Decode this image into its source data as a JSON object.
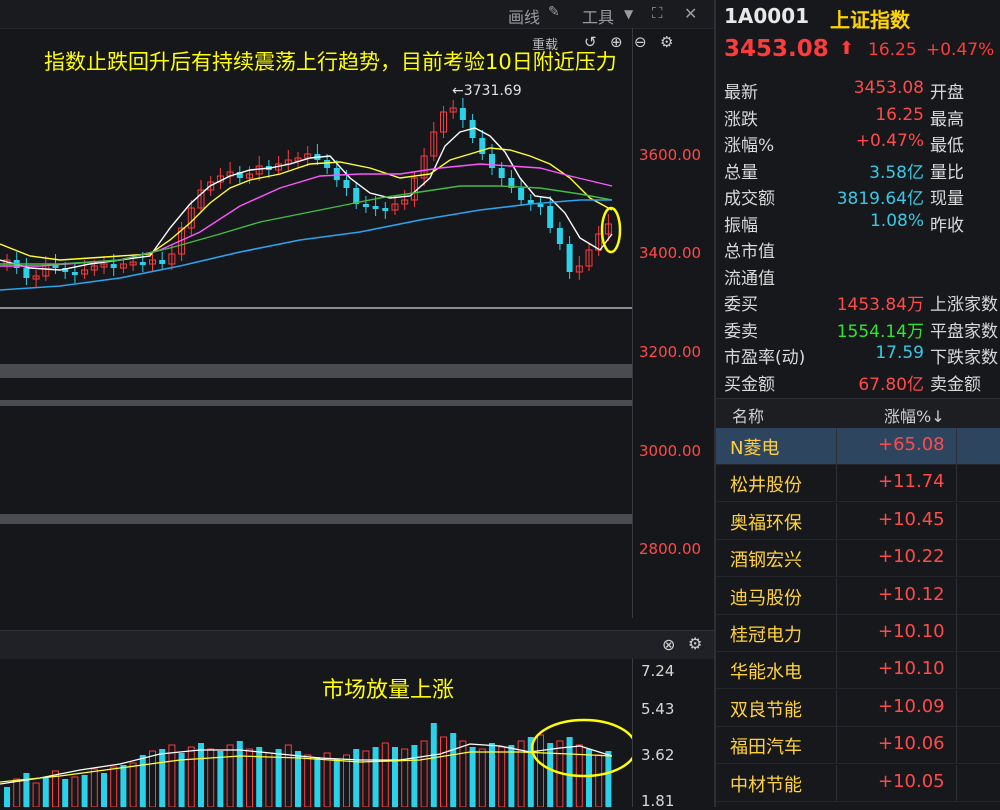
{
  "toolbar": {
    "draw_label": "画线",
    "tools_label": "工具",
    "more_label": "»",
    "restore_label": "重载"
  },
  "headline": "指数止跌回升后有持续震荡上行趋势，目前考验10日附近压力",
  "peak_label": "←3731.69",
  "price_axis": [
    "3600.00",
    "3400.00",
    "3200.00",
    "3000.00",
    "2800.00"
  ],
  "volume": {
    "note": "市场放量上涨",
    "axis": [
      "7.24",
      "5.43",
      "3.62",
      "1.81"
    ]
  },
  "quote": {
    "code": "1A0001",
    "name": "上证指数",
    "price": "3453.08",
    "change": "16.25",
    "change_pct": "+0.47%",
    "rows": [
      {
        "label": "最新",
        "value": "3453.08",
        "color": "#ff4a4a",
        "label2": "开盘"
      },
      {
        "label": "涨跌",
        "value": "16.25",
        "color": "#ff4a4a",
        "label2": "最高"
      },
      {
        "label": "涨幅%",
        "value": "+0.47%",
        "color": "#ff4a4a",
        "label2": "最低"
      },
      {
        "label": "总量",
        "value": "3.58亿",
        "color": "#37c9e6",
        "label2": "量比"
      },
      {
        "label": "成交额",
        "value": "3819.64亿",
        "color": "#37c9e6",
        "label2": "现量"
      },
      {
        "label": "振幅",
        "value": "1.08%",
        "color": "#37c9e6",
        "label2": "昨收"
      },
      {
        "label": "总市值",
        "value": "",
        "color": "#37c9e6",
        "label2": ""
      },
      {
        "label": "流通值",
        "value": "",
        "color": "#37c9e6",
        "label2": ""
      },
      {
        "label": "委买",
        "value": "1453.84万",
        "color": "#ff4a4a",
        "label2": "上涨家数"
      },
      {
        "label": "委卖",
        "value": "1554.14万",
        "color": "#2ee62e",
        "label2": "平盘家数"
      },
      {
        "label": "市盈率(动)",
        "value": "17.59",
        "color": "#37c9e6",
        "label2": "下跌家数"
      },
      {
        "label": "买金额",
        "value": "67.80亿",
        "color": "#ff4a4a",
        "label2": "卖金额"
      }
    ]
  },
  "stock_list": {
    "header": {
      "name": "名称",
      "pct": "涨幅%↓"
    },
    "items": [
      {
        "name": "N菱电",
        "pct": "+65.08"
      },
      {
        "name": "松井股份",
        "pct": "+11.74"
      },
      {
        "name": "奥福环保",
        "pct": "+10.45"
      },
      {
        "name": "酒钢宏兴",
        "pct": "+10.22"
      },
      {
        "name": "迪马股份",
        "pct": "+10.12"
      },
      {
        "name": "桂冠电力",
        "pct": "+10.10"
      },
      {
        "name": "华能水电",
        "pct": "+10.10"
      },
      {
        "name": "双良节能",
        "pct": "+10.09"
      },
      {
        "name": "福田汽车",
        "pct": "+10.06"
      },
      {
        "name": "中材节能",
        "pct": "+10.05"
      }
    ]
  },
  "colors": {
    "up": "#ff3b3b",
    "down": "#2ad1e8",
    "highlight": "#ffff00"
  }
}
